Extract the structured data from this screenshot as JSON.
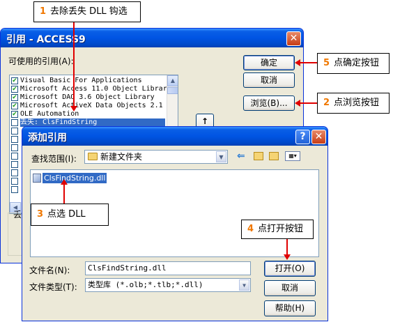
{
  "callouts": {
    "c1": {
      "num": "1",
      "text": "去除丢失 DLL 钩选"
    },
    "c2": {
      "num": "2",
      "text": "点浏览按钮"
    },
    "c3": {
      "num": "3",
      "text": "点选 DLL"
    },
    "c4": {
      "num": "4",
      "text": "点打开按钮"
    },
    "c5": {
      "num": "5",
      "text": "点确定按钮"
    }
  },
  "references_dialog": {
    "title": "引用 - ACCESS9",
    "available_label": "可使用的引用(A):",
    "items": [
      {
        "checked": true,
        "label": "Visual Basic For Applications"
      },
      {
        "checked": true,
        "label": "Microsoft Access 11.0 Object Librar"
      },
      {
        "checked": true,
        "label": "Microsoft DAO 3.6 Object Library"
      },
      {
        "checked": true,
        "label": "Microsoft ActiveX Data Objects 2.1"
      },
      {
        "checked": true,
        "label": "OLE Automation"
      },
      {
        "checked": false,
        "label": "丢失: ClsFindString",
        "selected": true
      }
    ],
    "ok_label": "确定",
    "cancel_label": "取消",
    "browse_label": "浏览(B)...",
    "priority_up": "↑",
    "lost_label": "丢"
  },
  "add_dialog": {
    "title": "添加引用",
    "lookin_label": "查找范围(I):",
    "lookin_value": "新建文件夹",
    "files": [
      {
        "name": "ClsFindString.dll",
        "selected": true
      }
    ],
    "filename_label": "文件名(N):",
    "filename_value": "ClsFindString.dll",
    "filetype_label": "文件类型(T):",
    "filetype_value": "类型库 (*.olb;*.tlb;*.dll)",
    "open_label": "打开(O)",
    "cancel_label": "取消",
    "help_label": "帮助(H)"
  },
  "colors": {
    "accent": "#f07800",
    "arrow": "#e00000",
    "selection": "#316ac5"
  }
}
